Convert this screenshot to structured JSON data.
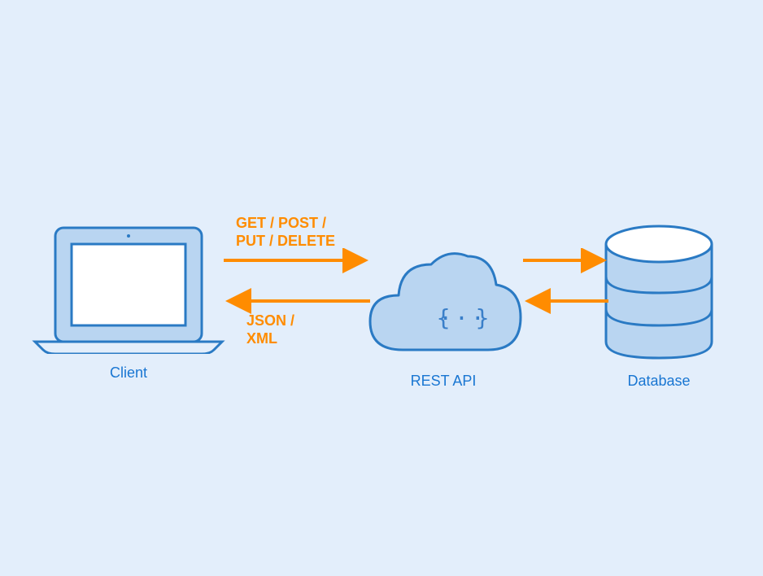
{
  "nodes": {
    "client": {
      "label": "Client"
    },
    "api": {
      "label": "REST API",
      "code_symbol": "{...}"
    },
    "database": {
      "label": "Database"
    }
  },
  "arrows": {
    "request_label": "GET / POST /\nPUT / DELETE",
    "response_label": "JSON /\nXML"
  },
  "colors": {
    "blue_stroke": "#2a7ac4",
    "blue_fill": "#b9d5f1",
    "light_blue_bg": "#e3eefb",
    "orange": "#ff8c00"
  }
}
